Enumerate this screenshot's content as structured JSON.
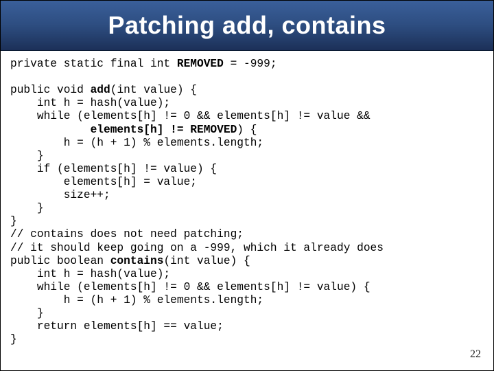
{
  "title": "Patching add, contains",
  "page_number": "22",
  "code": {
    "l01a": "private static final int ",
    "l01b": "REMOVED",
    "l01c": " = -999;",
    "l02": "",
    "l03a": "public void ",
    "l03b": "add",
    "l03c": "(int value) {",
    "l04": "    int h = hash(value);",
    "l05": "    while (elements[h] != 0 && elements[h] != value &&",
    "l06a": "            ",
    "l06b": "elements[h] != REMOVED",
    "l06c": ") {",
    "l07": "        h = (h + 1) % elements.length;",
    "l08": "    }",
    "l09": "    if (elements[h] != value) {",
    "l10": "        elements[h] = value;",
    "l11": "        size++;",
    "l12": "    }",
    "l13": "}",
    "l14": "// contains does not need patching;",
    "l15": "// it should keep going on a -999, which it already does",
    "l16a": "public boolean ",
    "l16b": "contains",
    "l16c": "(int value) {",
    "l17": "    int h = hash(value);",
    "l18": "    while (elements[h] != 0 && elements[h] != value) {",
    "l19": "        h = (h + 1) % elements.length;",
    "l20": "    }",
    "l21": "    return elements[h] == value;",
    "l22": "}"
  }
}
